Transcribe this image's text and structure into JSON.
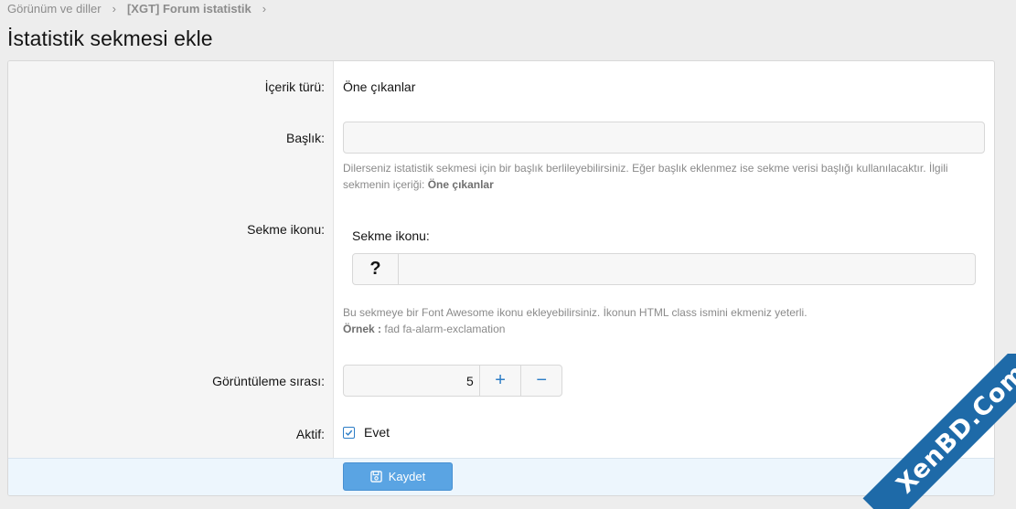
{
  "breadcrumb": {
    "items": [
      "Görünüm ve diller",
      "[XGT] Forum istatistik"
    ],
    "separator": "›"
  },
  "page": {
    "title": "İstatistik sekmesi ekle"
  },
  "form": {
    "content_type": {
      "label": "İçerik türü:",
      "value": "Öne çıkanlar"
    },
    "title_field": {
      "label": "Başlık:",
      "value": "",
      "hint_text": "Dilerseniz istatistik sekmesi için bir başlık berlileyebilirsiniz. Eğer başlık eklenmez ise sekme verisi başlığı kullanılacaktır. İlgili sekmenin içeriği:",
      "hint_bold": "Öne çıkanlar"
    },
    "tab_icon": {
      "label": "Sekme ikonu:",
      "sub_label": "Sekme ikonu:",
      "icon_glyph": "?",
      "value": "",
      "hint_text": "Bu sekmeye bir Font Awesome ikonu ekleyebilirsiniz. İkonun HTML class ismini ekmeniz yeterli.",
      "example_label": "Örnek :",
      "example_value": "fad fa-alarm-exclamation"
    },
    "display_order": {
      "label": "Görüntüleme sırası:",
      "value": "5",
      "plus": "+",
      "minus": "−"
    },
    "active": {
      "label": "Aktif:",
      "option_label": "Evet",
      "checked": true
    },
    "submit": {
      "label": "Kaydet"
    }
  },
  "watermark": {
    "text": "XenBD.Com"
  },
  "colors": {
    "accent": "#2d7dc6",
    "button": "#5aa4e3",
    "submit_row_bg": "#edf6fd",
    "watermark": "#1e6aa8"
  }
}
